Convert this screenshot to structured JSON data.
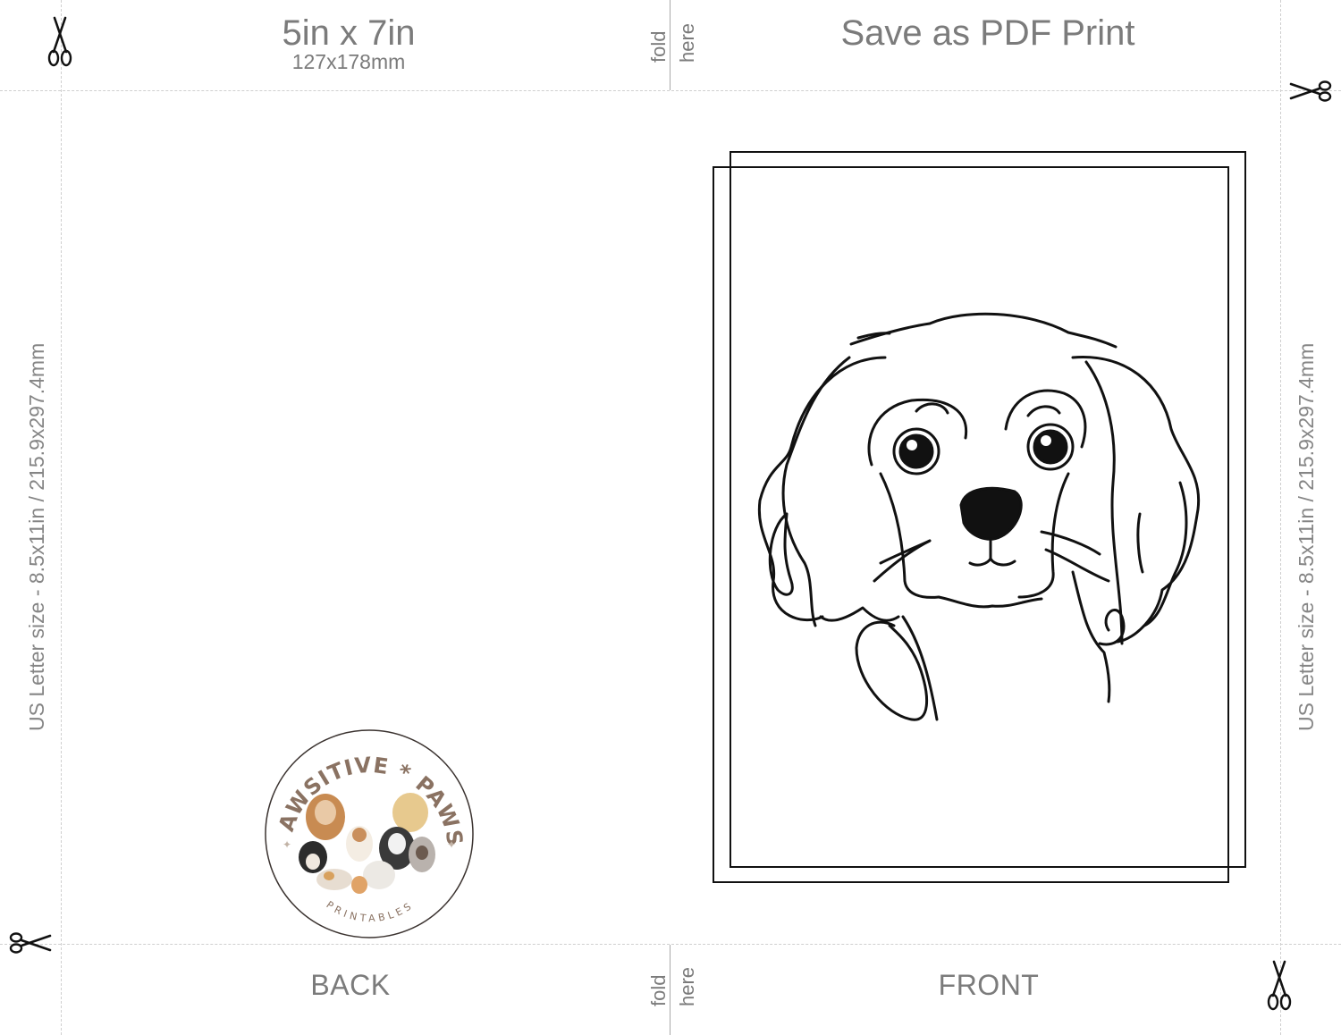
{
  "header": {
    "card_size": "5in x 7in",
    "card_size_mm": "127x178mm",
    "instruction": "Save as PDF Print"
  },
  "fold_labels": {
    "top": [
      "fold",
      "here"
    ],
    "bottom": [
      "fold",
      "here"
    ]
  },
  "side_labels": {
    "left": "US Letter size - 8.5x11in / 215.9x297.4mm",
    "right": "US Letter size - 8.5x11in / 215.9x297.4mm"
  },
  "panels": {
    "back": "BACK",
    "front": "FRONT"
  },
  "logo": {
    "brand": "PAWSITIVE * PAWS",
    "sub": "PRINTABLES"
  },
  "icons": [
    "scissors-icon",
    "dog-line-art",
    "pawsitive-paws-logo"
  ],
  "colors": {
    "label_gray": "#7b7b7b",
    "cut_line": "#cfcfcf",
    "line_art": "#111111",
    "logo_brown": "#8a7262"
  }
}
